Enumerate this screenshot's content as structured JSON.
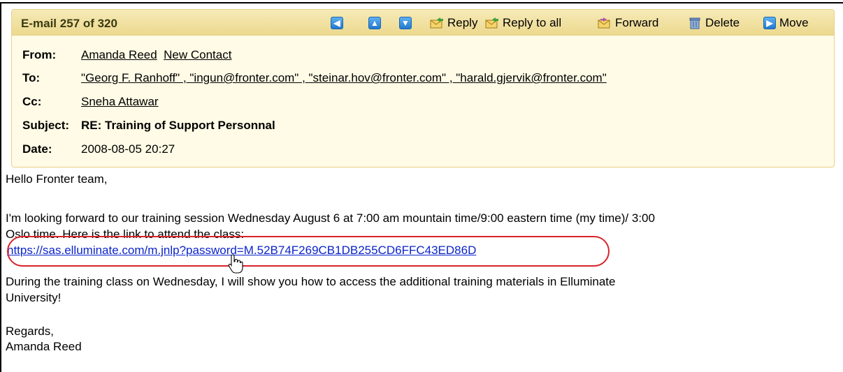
{
  "toolbar": {
    "counter": "E-mail 257 of 320",
    "reply": "Reply",
    "reply_all": "Reply to all",
    "forward": "Forward",
    "delete": "Delete",
    "move": "Move"
  },
  "header": {
    "from_label": "From:",
    "from_name": "Amanda Reed",
    "new_contact": "New Contact",
    "to_label": "To:",
    "to_value": "\"Georg F. Ranhoff\" , \"ingun@fronter.com\" , \"steinar.hov@fronter.com\" , \"harald.gjervik@fronter.com\"",
    "cc_label": "Cc:",
    "cc_value": "Sneha Attawar",
    "subject_label": "Subject:",
    "subject_value": "RE: Training of Support Personnal",
    "date_label": "Date:",
    "date_value": "2008-08-05 20:27"
  },
  "body": {
    "greeting": "Hello Fronter team,",
    "para1_line1": "I'm looking forward to our training session Wednesday August 6 at 7:00 am mountain time/9:00 eastern time (my time)/ 3:00",
    "para1_line2": "Oslo time. Here is the link to attend the class:",
    "link": "https://sas.elluminate.com/m.jnlp?password=M.52B74F269CB1DB255CD6FFC43ED86D",
    "para2_line1": "During the training class on Wednesday, I will show you how to access the additional training materials in Elluminate",
    "para2_line2": "University!",
    "regards": "Regards,",
    "signature": "Amanda Reed"
  },
  "colors": {
    "header_bg": "#fffbe6",
    "toolbar_bg": "#ecd98f",
    "link_blue": "#0b24c9",
    "highlight_red": "#d8232a"
  }
}
